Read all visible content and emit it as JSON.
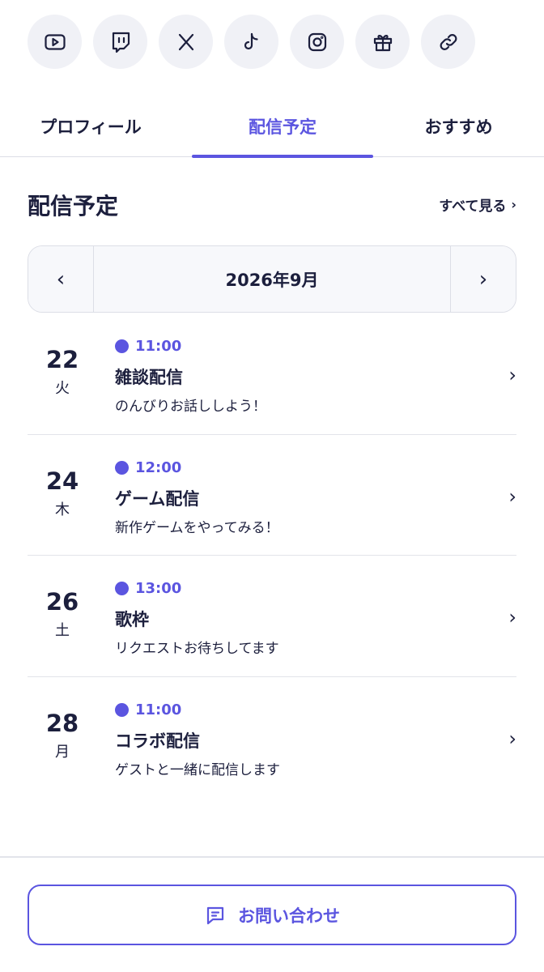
{
  "social": [
    {
      "icon": "youtube-icon"
    },
    {
      "icon": "twitch-icon"
    },
    {
      "icon": "x-icon"
    },
    {
      "icon": "tiktok-icon"
    },
    {
      "icon": "instagram-icon"
    },
    {
      "icon": "gift-icon"
    },
    {
      "icon": "link-icon"
    }
  ],
  "tabs": [
    {
      "label": "プロフィール",
      "active": false
    },
    {
      "label": "配信予定",
      "active": true
    },
    {
      "label": "おすすめ",
      "active": false
    }
  ],
  "section": {
    "title": "配信予定",
    "see_all": "すべて見る",
    "see_all_chevron": "›"
  },
  "month_nav": {
    "prev": "‹",
    "label": "2026年9月",
    "next": "›"
  },
  "events": [
    {
      "day": "22",
      "weekday": "火",
      "time": "11:00",
      "title": "雑談配信",
      "desc": "のんびりお話ししよう！"
    },
    {
      "day": "24",
      "weekday": "木",
      "time": "12:00",
      "title": "ゲーム配信",
      "desc": "新作ゲームをやってみる！"
    },
    {
      "day": "26",
      "weekday": "土",
      "time": "13:00",
      "title": "歌枠",
      "desc": "リクエストお待ちしてます"
    },
    {
      "day": "28",
      "weekday": "月",
      "time": "11:00",
      "title": "コラボ配信",
      "desc": "ゲストと一緒に配信します"
    }
  ],
  "row_chevron": "›",
  "contact": {
    "label": "お問い合わせ",
    "icon": "chat-icon"
  },
  "colors": {
    "accent": "#5b55e0",
    "text": "#1c1f3d",
    "icon_bg": "#f0f1f6"
  }
}
